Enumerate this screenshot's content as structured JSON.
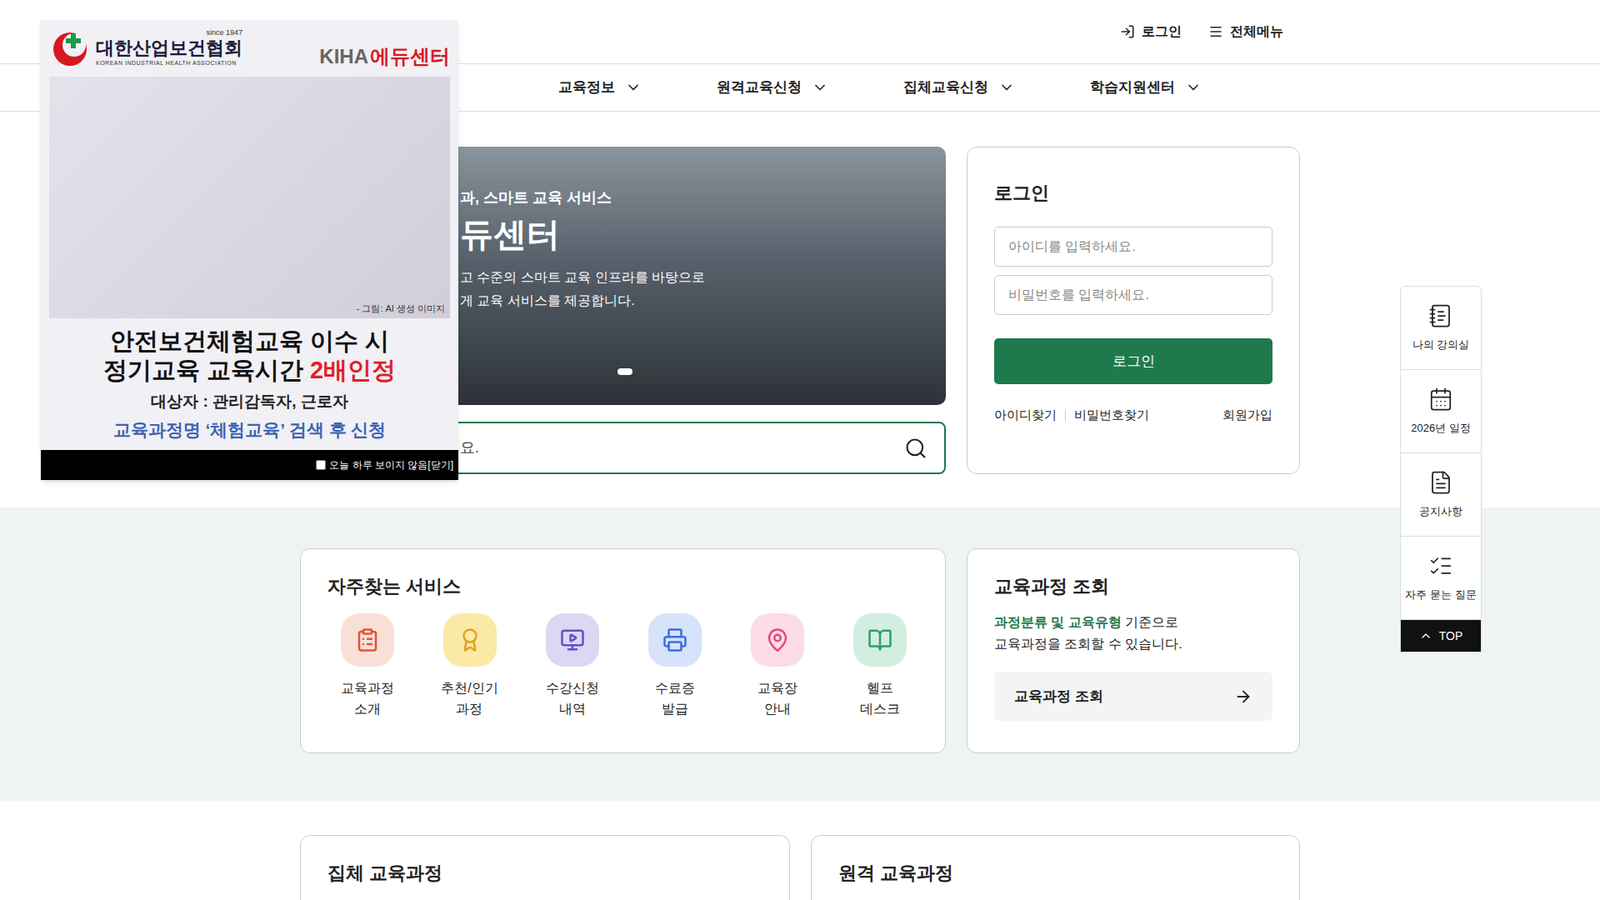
{
  "header": {
    "login": "로그인",
    "menu": "전체메뉴"
  },
  "nav": [
    {
      "label": "교육정보"
    },
    {
      "label": "원격교육신청"
    },
    {
      "label": "집체교육신청"
    },
    {
      "label": "학습지원센터"
    }
  ],
  "hero": {
    "subtitle": "과, 스마트 교육 서비스",
    "title": "듀센터",
    "lines": [
      "고 수준의 스마트 교육 인프라를 바탕으로",
      "게 교육 서비스를 제공합니다."
    ],
    "slides": [
      {
        "selected": false
      },
      {
        "selected": true
      },
      {
        "selected": false
      },
      {
        "selected": false
      }
    ]
  },
  "search": {
    "placeholder": "요."
  },
  "login": {
    "title": "로그인",
    "id_placeholder": "아이디를 입력하세요.",
    "pw_placeholder": "비밀번호를 입력하세요.",
    "button": "로그인",
    "find_id": "아이디찾기",
    "find_pw": "비밀번호찾기",
    "join": "회원가입"
  },
  "services": {
    "title": "자주찾는 서비스",
    "items": [
      {
        "lines": [
          "교육과정",
          "소개"
        ],
        "color": "#f8e0d6"
      },
      {
        "lines": [
          "추천/인기",
          "과정"
        ],
        "color": "#fbeaa6"
      },
      {
        "lines": [
          "수강신청",
          "내역"
        ],
        "color": "#ddd7f4"
      },
      {
        "lines": [
          "수료증",
          "발급"
        ],
        "color": "#d6e3fb"
      },
      {
        "lines": [
          "교육장",
          "안내"
        ],
        "color": "#fbdce6"
      },
      {
        "lines": [
          "헬프",
          "데스크"
        ],
        "color": "#d3eee1"
      }
    ]
  },
  "course_search": {
    "title": "교육과정 조회",
    "highlight": "과정분류 및 교육유형",
    "rest": " 기준으로",
    "line2": "교육과정을 조회할 수 있습니다.",
    "button": "교육과정 조회"
  },
  "bottom_cards": [
    "집체 교육과정",
    "원격 교육과정"
  ],
  "quick_menu": {
    "items": [
      "나의 강의실",
      "2026년 일정",
      "공지사항",
      "자주 묻는 질문"
    ],
    "top": "TOP"
  },
  "popup": {
    "since": "since 1947",
    "org": "대한산업보건협회",
    "org_en": "KOREAN INDUSTRIAL HEALTH ASSOCIATION",
    "brand": "KIHA",
    "brand2": "에듀센터",
    "caption": "- 그림: AI 생성 이미지",
    "headline1": "안전보건체험교육 이수 시",
    "headline2": "정기교육 교육시간 ",
    "headline2_em": "2배인정",
    "target": "대상자 : 관리감독자, 근로자",
    "guide": "교육과정명 ‘체험교육’ 검색 후 신청",
    "dismiss": "오늘 하루 보이지 않음[닫기]",
    "dismiss_checked": false
  }
}
